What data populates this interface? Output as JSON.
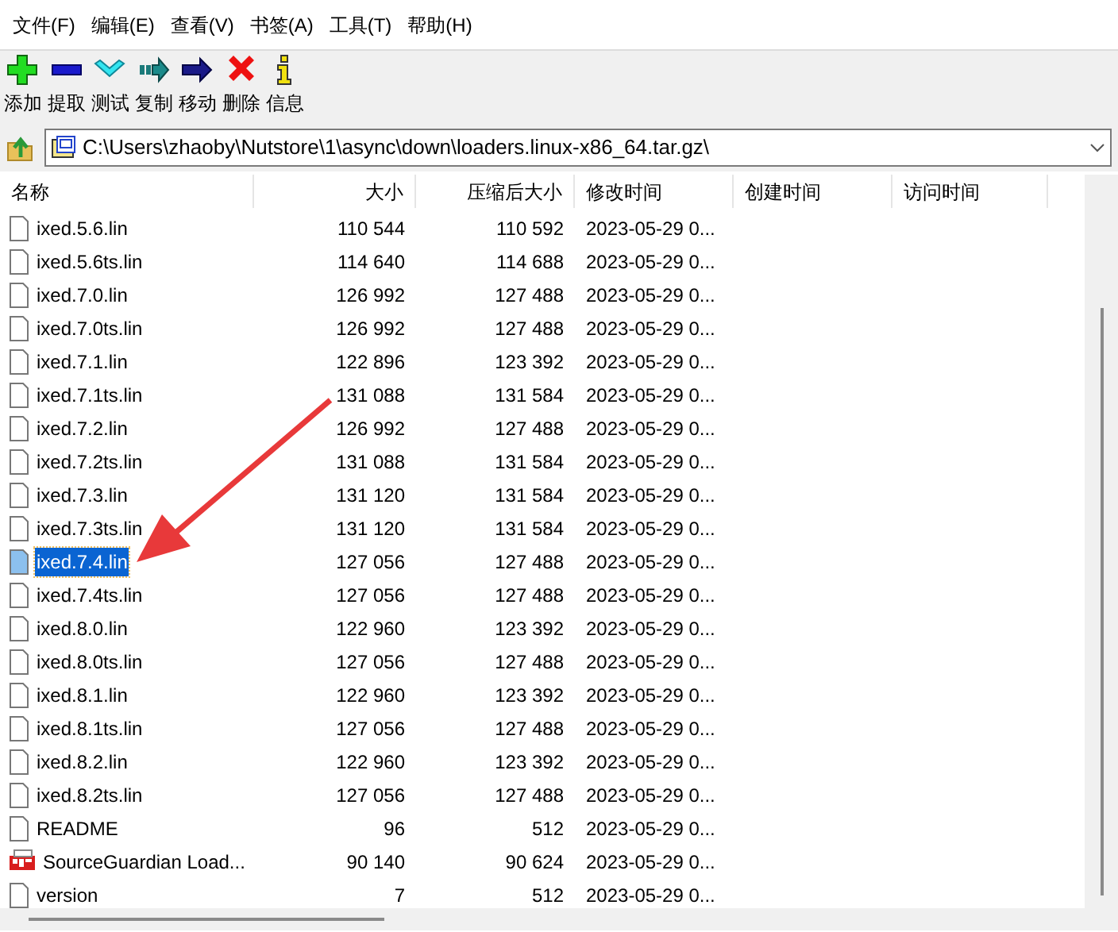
{
  "menu": [
    "文件(F)",
    "编辑(E)",
    "查看(V)",
    "书签(A)",
    "工具(T)",
    "帮助(H)"
  ],
  "toolbar": [
    {
      "kind": "add",
      "label": "添加"
    },
    {
      "kind": "extract",
      "label": "提取"
    },
    {
      "kind": "test",
      "label": "测试"
    },
    {
      "kind": "copy",
      "label": "复制"
    },
    {
      "kind": "move",
      "label": "移动"
    },
    {
      "kind": "delete",
      "label": "删除"
    },
    {
      "kind": "info",
      "label": "信息"
    }
  ],
  "address": {
    "value": "C:\\Users\\zhaoby\\Nutstore\\1\\async\\down\\loaders.linux-x86_64.tar.gz\\"
  },
  "table": {
    "columns": [
      "名称",
      "大小",
      "压缩后大小",
      "修改时间",
      "创建时间",
      "访问时间"
    ],
    "rows": [
      {
        "kind": "file",
        "name": "ixed.5.6.lin",
        "size": "110 544",
        "packed": "110 592",
        "modified": "2023-05-29 0...",
        "selected": false
      },
      {
        "kind": "file",
        "name": "ixed.5.6ts.lin",
        "size": "114 640",
        "packed": "114 688",
        "modified": "2023-05-29 0...",
        "selected": false
      },
      {
        "kind": "file",
        "name": "ixed.7.0.lin",
        "size": "126 992",
        "packed": "127 488",
        "modified": "2023-05-29 0...",
        "selected": false
      },
      {
        "kind": "file",
        "name": "ixed.7.0ts.lin",
        "size": "126 992",
        "packed": "127 488",
        "modified": "2023-05-29 0...",
        "selected": false
      },
      {
        "kind": "file",
        "name": "ixed.7.1.lin",
        "size": "122 896",
        "packed": "123 392",
        "modified": "2023-05-29 0...",
        "selected": false
      },
      {
        "kind": "file",
        "name": "ixed.7.1ts.lin",
        "size": "131 088",
        "packed": "131 584",
        "modified": "2023-05-29 0...",
        "selected": false
      },
      {
        "kind": "file",
        "name": "ixed.7.2.lin",
        "size": "126 992",
        "packed": "127 488",
        "modified": "2023-05-29 0...",
        "selected": false
      },
      {
        "kind": "file",
        "name": "ixed.7.2ts.lin",
        "size": "131 088",
        "packed": "131 584",
        "modified": "2023-05-29 0...",
        "selected": false
      },
      {
        "kind": "file",
        "name": "ixed.7.3.lin",
        "size": "131 120",
        "packed": "131 584",
        "modified": "2023-05-29 0...",
        "selected": false
      },
      {
        "kind": "file",
        "name": "ixed.7.3ts.lin",
        "size": "131 120",
        "packed": "131 584",
        "modified": "2023-05-29 0...",
        "selected": false
      },
      {
        "kind": "file",
        "name": "ixed.7.4.lin",
        "size": "127 056",
        "packed": "127 488",
        "modified": "2023-05-29 0...",
        "selected": true
      },
      {
        "kind": "file",
        "name": "ixed.7.4ts.lin",
        "size": "127 056",
        "packed": "127 488",
        "modified": "2023-05-29 0...",
        "selected": false
      },
      {
        "kind": "file",
        "name": "ixed.8.0.lin",
        "size": "122 960",
        "packed": "123 392",
        "modified": "2023-05-29 0...",
        "selected": false
      },
      {
        "kind": "file",
        "name": "ixed.8.0ts.lin",
        "size": "127 056",
        "packed": "127 488",
        "modified": "2023-05-29 0...",
        "selected": false
      },
      {
        "kind": "file",
        "name": "ixed.8.1.lin",
        "size": "122 960",
        "packed": "123 392",
        "modified": "2023-05-29 0...",
        "selected": false
      },
      {
        "kind": "file",
        "name": "ixed.8.1ts.lin",
        "size": "127 056",
        "packed": "127 488",
        "modified": "2023-05-29 0...",
        "selected": false
      },
      {
        "kind": "file",
        "name": "ixed.8.2.lin",
        "size": "122 960",
        "packed": "123 392",
        "modified": "2023-05-29 0...",
        "selected": false
      },
      {
        "kind": "file",
        "name": "ixed.8.2ts.lin",
        "size": "127 056",
        "packed": "127 488",
        "modified": "2023-05-29 0...",
        "selected": false
      },
      {
        "kind": "file",
        "name": "README",
        "size": "96",
        "packed": "512",
        "modified": "2023-05-29 0...",
        "selected": false
      },
      {
        "kind": "pdf",
        "name": "SourceGuardian Load...",
        "size": "90 140",
        "packed": "90 624",
        "modified": "2023-05-29 0...",
        "selected": false
      },
      {
        "kind": "file",
        "name": "version",
        "size": "7",
        "packed": "512",
        "modified": "2023-05-29 0...",
        "selected": false
      }
    ]
  }
}
